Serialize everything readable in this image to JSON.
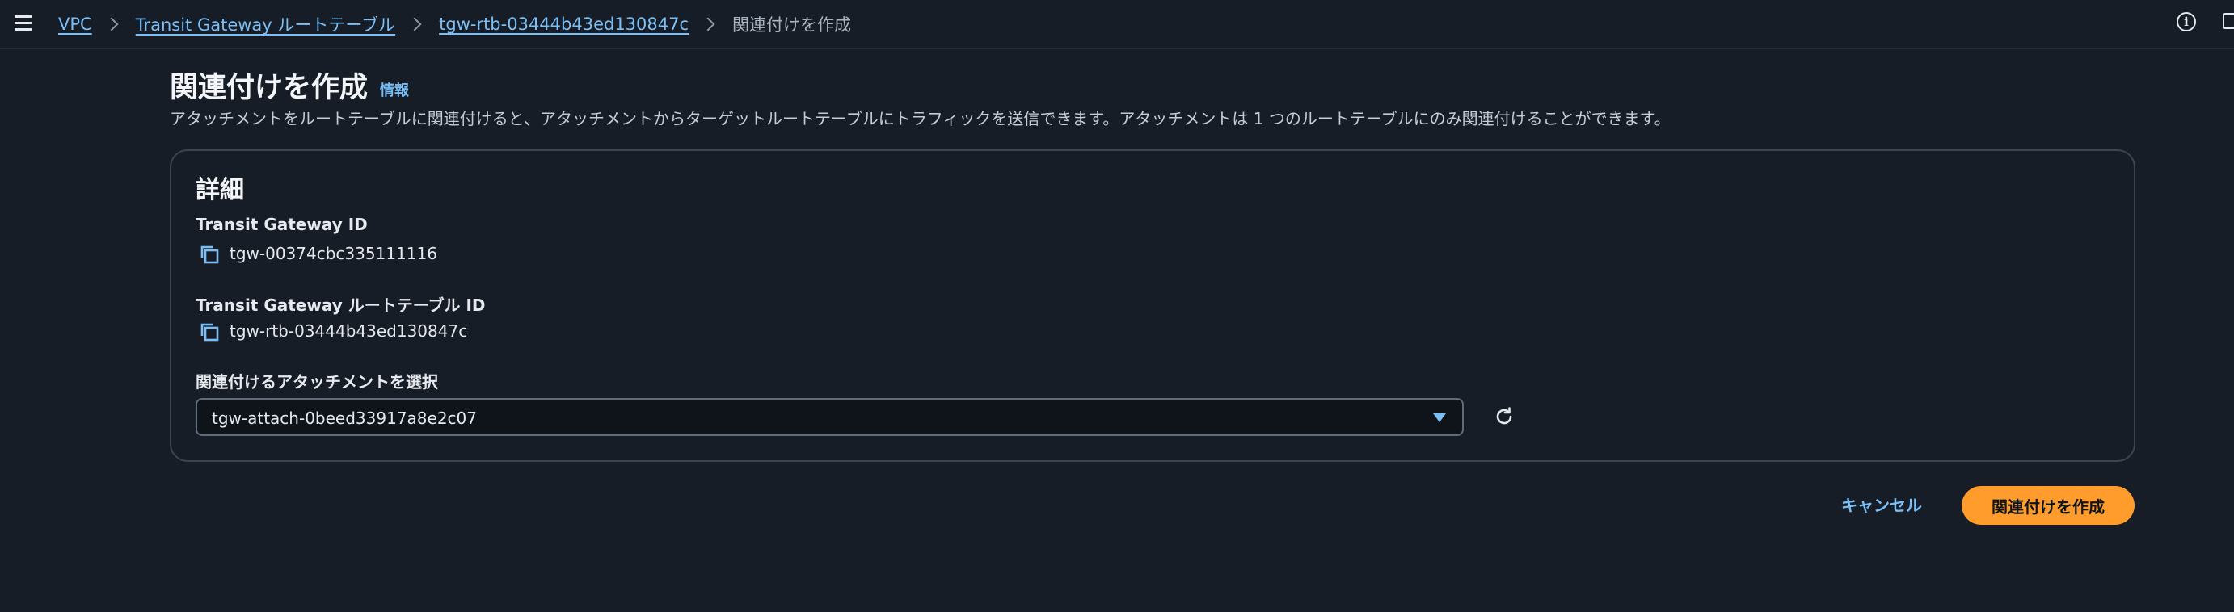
{
  "breadcrumb": {
    "items": [
      {
        "label": "VPC"
      },
      {
        "label": "Transit Gateway ルートテーブル"
      },
      {
        "label": "tgw-rtb-03444b43ed130847c"
      }
    ],
    "current": "関連付けを作成"
  },
  "header": {
    "title": "関連付けを作成",
    "info_label": "情報",
    "description": "アタッチメントをルートテーブルに関連付けると、アタッチメントからターゲットルートテーブルにトラフィックを送信できます。アタッチメントは 1 つのルートテーブルにのみ関連付けることができます。"
  },
  "details": {
    "title": "詳細",
    "fields": [
      {
        "label": "Transit Gateway ID",
        "value": "tgw-00374cbc335111116"
      },
      {
        "label": "Transit Gateway ルートテーブル ID",
        "value": "tgw-rtb-03444b43ed130847c"
      }
    ],
    "select": {
      "label": "関連付けるアタッチメントを選択",
      "value": "tgw-attach-0beed33917a8e2c07"
    }
  },
  "actions": {
    "cancel_label": "キャンセル",
    "submit_label": "関連付けを作成"
  },
  "colors": {
    "background": "#161d26",
    "link": "#7bbff7",
    "primary": "#ff9c2b"
  },
  "icons": [
    "menu-icon",
    "chevron-right-icon",
    "info-circle-icon",
    "feedback-icon",
    "copy-icon",
    "caret-down-icon",
    "refresh-icon"
  ]
}
